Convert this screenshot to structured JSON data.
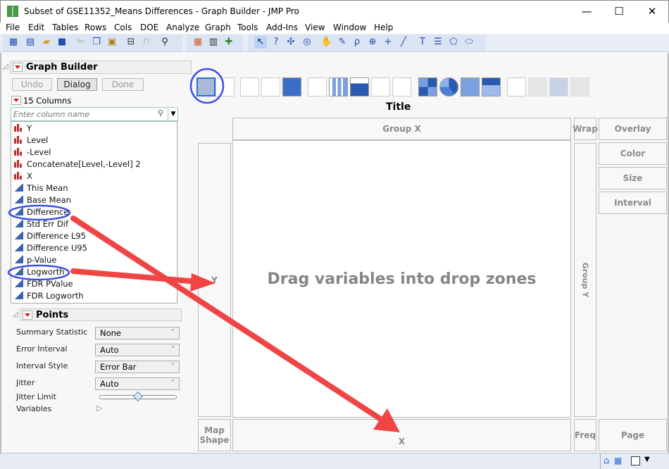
{
  "window": {
    "title": "Subset of GSE11352_Means Differences - Graph Builder - JMP Pro",
    "minimize": "—",
    "maximize": "☐",
    "close": "✕"
  },
  "menu": [
    "File",
    "Edit",
    "Tables",
    "Rows",
    "Cols",
    "DOE",
    "Analyze",
    "Graph",
    "Tools",
    "Add-Ins",
    "View",
    "Window",
    "Help"
  ],
  "graph_builder": {
    "title": "Graph Builder",
    "undo": "Undo",
    "dialog": "Dialog",
    "done": "Done",
    "columns_label": "15 Columns",
    "search_placeholder": "Enter column name",
    "columns": [
      {
        "name": "Y",
        "type": "nominal"
      },
      {
        "name": "Level",
        "type": "nominal"
      },
      {
        "name": "-Level",
        "type": "nominal"
      },
      {
        "name": "Concatenate[Level,-Level] 2",
        "type": "nominal"
      },
      {
        "name": "X",
        "type": "nominal"
      },
      {
        "name": "This Mean",
        "type": "continuous"
      },
      {
        "name": "Base Mean",
        "type": "continuous"
      },
      {
        "name": "Difference",
        "type": "continuous"
      },
      {
        "name": "Std Err Dif",
        "type": "continuous"
      },
      {
        "name": "Difference L95",
        "type": "continuous"
      },
      {
        "name": "Difference U95",
        "type": "continuous"
      },
      {
        "name": "p-Value",
        "type": "continuous"
      },
      {
        "name": "Logworth",
        "type": "continuous"
      },
      {
        "name": "FDR PValue",
        "type": "continuous"
      },
      {
        "name": "FDR Logworth",
        "type": "continuous"
      }
    ]
  },
  "points": {
    "title": "Points",
    "summary_statistic_label": "Summary Statistic",
    "summary_statistic": "None",
    "error_interval_label": "Error Interval",
    "error_interval": "Auto",
    "interval_style_label": "Interval Style",
    "interval_style": "Error Bar",
    "jitter_label": "Jitter",
    "jitter": "Auto",
    "jitter_limit_label": "Jitter Limit",
    "jitter_limit": 0.5,
    "variables_label": "Variables"
  },
  "canvas": {
    "title": "Title",
    "group_x": "Group X",
    "wrap": "Wrap",
    "overlay": "Overlay",
    "color": "Color",
    "size": "Size",
    "interval": "Interval",
    "y": "Y",
    "group_y": "Group Y",
    "drop_hint": "Drag variables into drop zones",
    "map_shape": "Map Shape",
    "x": "X",
    "freq": "Freq",
    "page": "Page"
  },
  "colors": {
    "annotation_arrow": "#f04545",
    "annotation_circle": "#3b4ee8"
  }
}
